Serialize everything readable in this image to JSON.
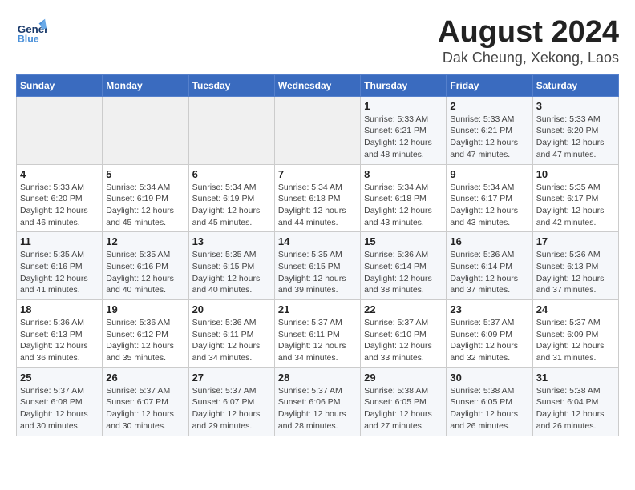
{
  "header": {
    "logo_line1": "General",
    "logo_line2": "Blue",
    "month_year": "August 2024",
    "location": "Dak Cheung, Xekong, Laos"
  },
  "weekdays": [
    "Sunday",
    "Monday",
    "Tuesday",
    "Wednesday",
    "Thursday",
    "Friday",
    "Saturday"
  ],
  "weeks": [
    [
      {
        "day": "",
        "info": ""
      },
      {
        "day": "",
        "info": ""
      },
      {
        "day": "",
        "info": ""
      },
      {
        "day": "",
        "info": ""
      },
      {
        "day": "1",
        "info": "Sunrise: 5:33 AM\nSunset: 6:21 PM\nDaylight: 12 hours\nand 48 minutes."
      },
      {
        "day": "2",
        "info": "Sunrise: 5:33 AM\nSunset: 6:21 PM\nDaylight: 12 hours\nand 47 minutes."
      },
      {
        "day": "3",
        "info": "Sunrise: 5:33 AM\nSunset: 6:20 PM\nDaylight: 12 hours\nand 47 minutes."
      }
    ],
    [
      {
        "day": "4",
        "info": "Sunrise: 5:33 AM\nSunset: 6:20 PM\nDaylight: 12 hours\nand 46 minutes."
      },
      {
        "day": "5",
        "info": "Sunrise: 5:34 AM\nSunset: 6:19 PM\nDaylight: 12 hours\nand 45 minutes."
      },
      {
        "day": "6",
        "info": "Sunrise: 5:34 AM\nSunset: 6:19 PM\nDaylight: 12 hours\nand 45 minutes."
      },
      {
        "day": "7",
        "info": "Sunrise: 5:34 AM\nSunset: 6:18 PM\nDaylight: 12 hours\nand 44 minutes."
      },
      {
        "day": "8",
        "info": "Sunrise: 5:34 AM\nSunset: 6:18 PM\nDaylight: 12 hours\nand 43 minutes."
      },
      {
        "day": "9",
        "info": "Sunrise: 5:34 AM\nSunset: 6:17 PM\nDaylight: 12 hours\nand 43 minutes."
      },
      {
        "day": "10",
        "info": "Sunrise: 5:35 AM\nSunset: 6:17 PM\nDaylight: 12 hours\nand 42 minutes."
      }
    ],
    [
      {
        "day": "11",
        "info": "Sunrise: 5:35 AM\nSunset: 6:16 PM\nDaylight: 12 hours\nand 41 minutes."
      },
      {
        "day": "12",
        "info": "Sunrise: 5:35 AM\nSunset: 6:16 PM\nDaylight: 12 hours\nand 40 minutes."
      },
      {
        "day": "13",
        "info": "Sunrise: 5:35 AM\nSunset: 6:15 PM\nDaylight: 12 hours\nand 40 minutes."
      },
      {
        "day": "14",
        "info": "Sunrise: 5:35 AM\nSunset: 6:15 PM\nDaylight: 12 hours\nand 39 minutes."
      },
      {
        "day": "15",
        "info": "Sunrise: 5:36 AM\nSunset: 6:14 PM\nDaylight: 12 hours\nand 38 minutes."
      },
      {
        "day": "16",
        "info": "Sunrise: 5:36 AM\nSunset: 6:14 PM\nDaylight: 12 hours\nand 37 minutes."
      },
      {
        "day": "17",
        "info": "Sunrise: 5:36 AM\nSunset: 6:13 PM\nDaylight: 12 hours\nand 37 minutes."
      }
    ],
    [
      {
        "day": "18",
        "info": "Sunrise: 5:36 AM\nSunset: 6:13 PM\nDaylight: 12 hours\nand 36 minutes."
      },
      {
        "day": "19",
        "info": "Sunrise: 5:36 AM\nSunset: 6:12 PM\nDaylight: 12 hours\nand 35 minutes."
      },
      {
        "day": "20",
        "info": "Sunrise: 5:36 AM\nSunset: 6:11 PM\nDaylight: 12 hours\nand 34 minutes."
      },
      {
        "day": "21",
        "info": "Sunrise: 5:37 AM\nSunset: 6:11 PM\nDaylight: 12 hours\nand 34 minutes."
      },
      {
        "day": "22",
        "info": "Sunrise: 5:37 AM\nSunset: 6:10 PM\nDaylight: 12 hours\nand 33 minutes."
      },
      {
        "day": "23",
        "info": "Sunrise: 5:37 AM\nSunset: 6:09 PM\nDaylight: 12 hours\nand 32 minutes."
      },
      {
        "day": "24",
        "info": "Sunrise: 5:37 AM\nSunset: 6:09 PM\nDaylight: 12 hours\nand 31 minutes."
      }
    ],
    [
      {
        "day": "25",
        "info": "Sunrise: 5:37 AM\nSunset: 6:08 PM\nDaylight: 12 hours\nand 30 minutes."
      },
      {
        "day": "26",
        "info": "Sunrise: 5:37 AM\nSunset: 6:07 PM\nDaylight: 12 hours\nand 30 minutes."
      },
      {
        "day": "27",
        "info": "Sunrise: 5:37 AM\nSunset: 6:07 PM\nDaylight: 12 hours\nand 29 minutes."
      },
      {
        "day": "28",
        "info": "Sunrise: 5:37 AM\nSunset: 6:06 PM\nDaylight: 12 hours\nand 28 minutes."
      },
      {
        "day": "29",
        "info": "Sunrise: 5:38 AM\nSunset: 6:05 PM\nDaylight: 12 hours\nand 27 minutes."
      },
      {
        "day": "30",
        "info": "Sunrise: 5:38 AM\nSunset: 6:05 PM\nDaylight: 12 hours\nand 26 minutes."
      },
      {
        "day": "31",
        "info": "Sunrise: 5:38 AM\nSunset: 6:04 PM\nDaylight: 12 hours\nand 26 minutes."
      }
    ]
  ]
}
